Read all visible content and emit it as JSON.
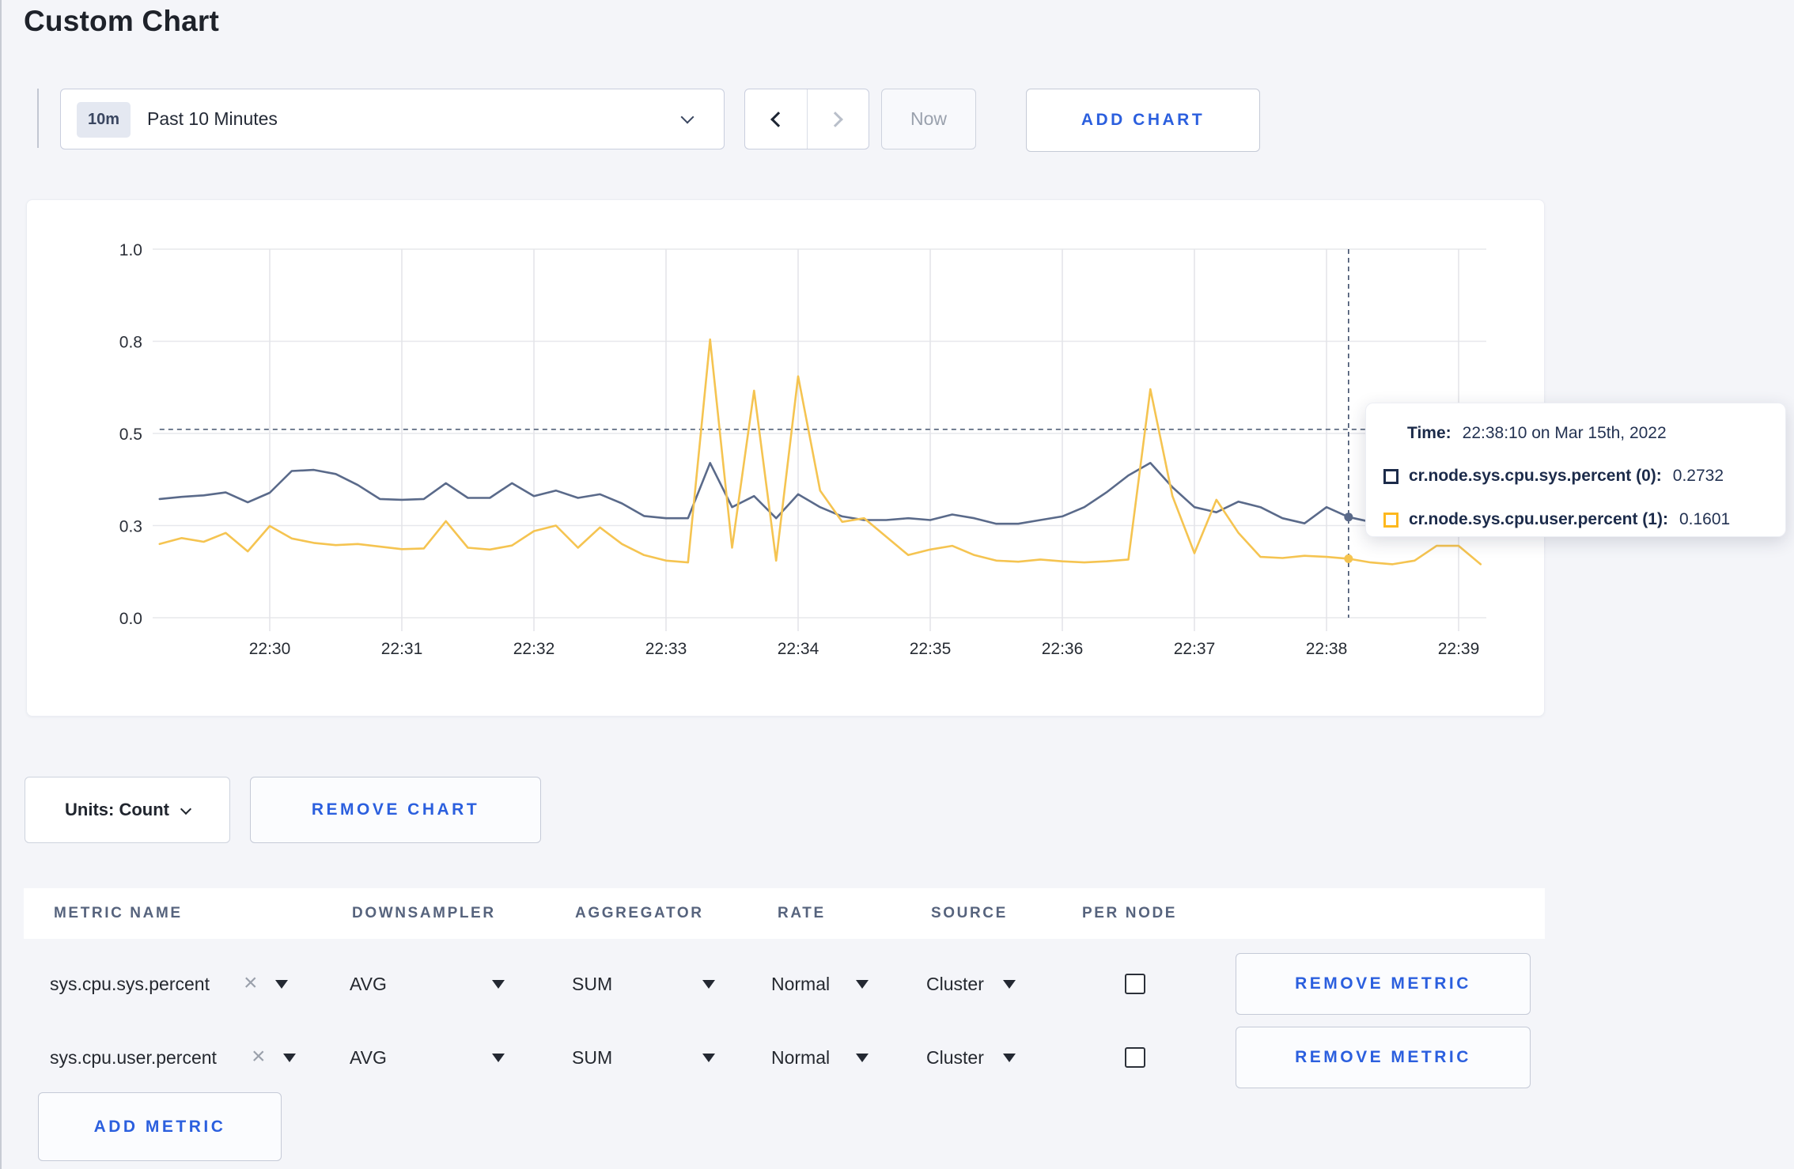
{
  "page": {
    "title": "Custom Chart"
  },
  "toolbar": {
    "time_badge": "10m",
    "time_range_label": "Past 10 Minutes",
    "now_label": "Now",
    "add_chart_label": "ADD CHART"
  },
  "chart_controls": {
    "units_label": "Units: Count",
    "remove_chart_label": "REMOVE CHART"
  },
  "tooltip": {
    "time_label": "Time:",
    "time_value": "22:38:10 on Mar 15th, 2022",
    "series": [
      {
        "label": "cr.node.sys.cpu.sys.percent (0):",
        "value": "0.2732",
        "color": "#1c2b4a"
      },
      {
        "label": "cr.node.sys.cpu.user.percent (1):",
        "value": "0.1601",
        "color": "#fdb81e"
      }
    ]
  },
  "chart_data": {
    "type": "line",
    "title": "",
    "xlabel": "",
    "ylabel": "",
    "ylim": [
      0,
      1
    ],
    "grid": true,
    "x_ticks": [
      "22:30",
      "22:31",
      "22:32",
      "22:33",
      "22:34",
      "22:35",
      "22:36",
      "22:37",
      "22:38",
      "22:39"
    ],
    "y_ticks": [
      {
        "label": "0.0",
        "v": 0
      },
      {
        "label": "0.3",
        "v": 0.25
      },
      {
        "label": "0.5",
        "v": 0.5
      },
      {
        "label": "0.8",
        "v": 0.75
      },
      {
        "label": "1.0",
        "v": 1
      }
    ],
    "start_offset_seconds": -50,
    "sample_interval_seconds": 10,
    "series": [
      {
        "name": "cr.node.sys.cpu.sys.percent",
        "color": "#5a6a8a",
        "values": [
          0.322,
          0.328,
          0.332,
          0.34,
          0.313,
          0.339,
          0.398,
          0.401,
          0.39,
          0.36,
          0.322,
          0.32,
          0.322,
          0.365,
          0.325,
          0.325,
          0.365,
          0.33,
          0.345,
          0.325,
          0.335,
          0.31,
          0.276,
          0.27,
          0.27,
          0.42,
          0.3,
          0.33,
          0.27,
          0.335,
          0.3,
          0.275,
          0.265,
          0.265,
          0.27,
          0.265,
          0.28,
          0.27,
          0.255,
          0.255,
          0.265,
          0.275,
          0.3,
          0.34,
          0.386,
          0.42,
          0.354,
          0.3,
          0.286,
          0.315,
          0.3,
          0.27,
          0.256,
          0.3,
          0.2732,
          0.26,
          0.285,
          0.3,
          0.285,
          0.275,
          0.285
        ]
      },
      {
        "name": "cr.node.sys.cpu.user.percent",
        "color": "#f5c451",
        "values": [
          0.2,
          0.216,
          0.206,
          0.23,
          0.18,
          0.249,
          0.215,
          0.203,
          0.197,
          0.2,
          0.193,
          0.186,
          0.188,
          0.262,
          0.19,
          0.185,
          0.196,
          0.235,
          0.25,
          0.19,
          0.245,
          0.2,
          0.17,
          0.155,
          0.15,
          0.755,
          0.19,
          0.616,
          0.155,
          0.655,
          0.345,
          0.26,
          0.27,
          0.22,
          0.17,
          0.185,
          0.195,
          0.17,
          0.155,
          0.152,
          0.158,
          0.153,
          0.15,
          0.153,
          0.158,
          0.62,
          0.33,
          0.175,
          0.32,
          0.23,
          0.165,
          0.162,
          0.168,
          0.165,
          0.1601,
          0.15,
          0.145,
          0.155,
          0.195,
          0.195,
          0.145
        ]
      }
    ],
    "crosshair": {
      "index": 54,
      "time_label": "22:38:10",
      "hline_value": 0.511
    }
  },
  "metrics_table": {
    "headers": [
      "METRIC NAME",
      "DOWNSAMPLER",
      "AGGREGATOR",
      "RATE",
      "SOURCE",
      "PER NODE"
    ],
    "rows": [
      {
        "metric": "sys.cpu.sys.percent",
        "downsampler": "AVG",
        "aggregator": "SUM",
        "rate": "Normal",
        "source": "Cluster",
        "per_node": false,
        "remove_label": "REMOVE METRIC"
      },
      {
        "metric": "sys.cpu.user.percent",
        "downsampler": "AVG",
        "aggregator": "SUM",
        "rate": "Normal",
        "source": "Cluster",
        "per_node": false,
        "remove_label": "REMOVE METRIC"
      }
    ],
    "add_metric_label": "ADD METRIC"
  }
}
